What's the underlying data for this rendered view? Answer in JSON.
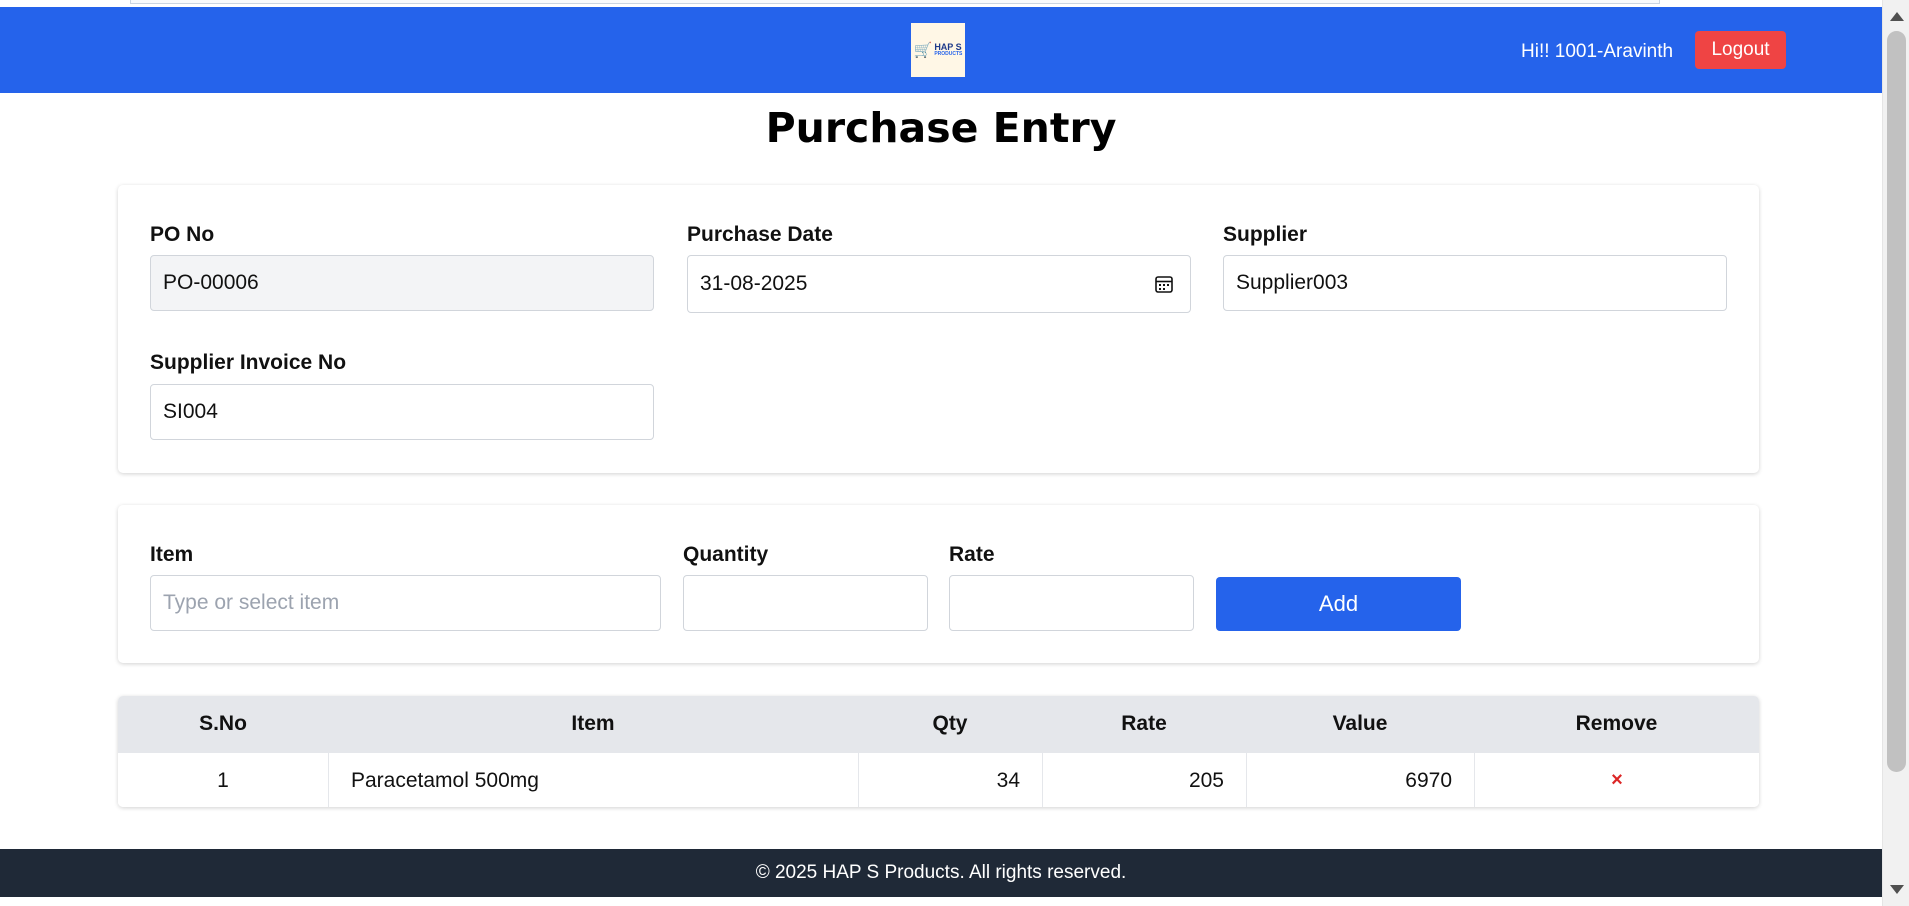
{
  "header": {
    "logo_text": "HAP S",
    "logo_subtext": "PRODUCTS",
    "greeting": "Hi!! 1001-Aravinth",
    "logout_label": "Logout"
  },
  "page": {
    "title": "Purchase Entry"
  },
  "form": {
    "po_no_label": "PO No",
    "po_no_value": "PO-00006",
    "purchase_date_label": "Purchase Date",
    "purchase_date_value": "31-08-2025",
    "supplier_label": "Supplier",
    "supplier_value": "Supplier003",
    "supplier_invoice_label": "Supplier Invoice No",
    "supplier_invoice_value": "SI004"
  },
  "item_entry": {
    "item_label": "Item",
    "item_placeholder": "Type or select item",
    "quantity_label": "Quantity",
    "quantity_value": "",
    "rate_label": "Rate",
    "rate_value": "",
    "add_label": "Add"
  },
  "table": {
    "headers": [
      "S.No",
      "Item",
      "Qty",
      "Rate",
      "Value",
      "Remove"
    ],
    "rows": [
      {
        "sno": "1",
        "item": "Paracetamol 500mg",
        "qty": "34",
        "rate": "205",
        "value": "6970",
        "remove": "×"
      }
    ]
  },
  "footer": {
    "text": "© 2025 HAP S Products. All rights reserved."
  },
  "colors": {
    "header_bg": "#2563eb",
    "logout_bg": "#ef4444",
    "add_bg": "#2563eb",
    "footer_bg": "#1f2937",
    "remove_color": "#dc2626"
  }
}
